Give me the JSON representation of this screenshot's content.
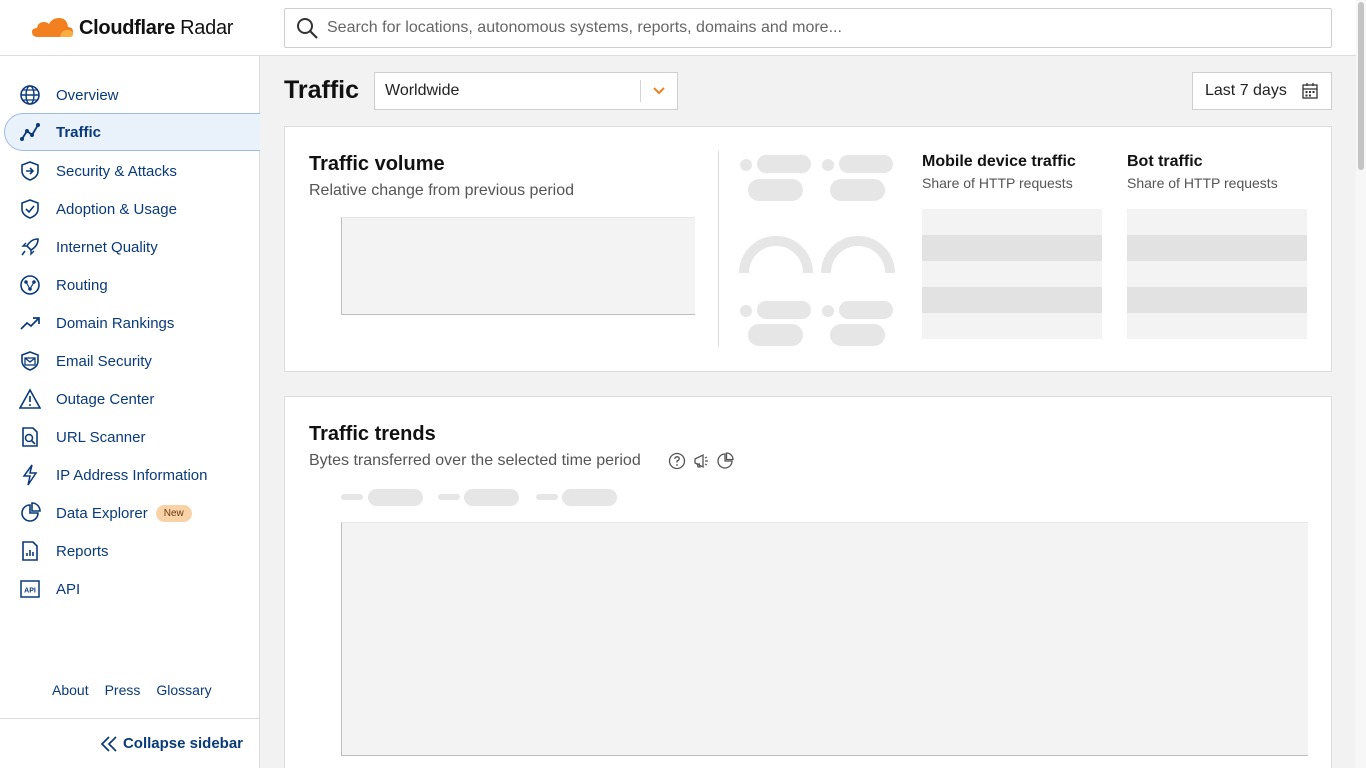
{
  "header": {
    "logo_brand": "Cloudflare",
    "logo_product": " Radar",
    "search_placeholder": "Search for locations, autonomous systems, reports, domains and more..."
  },
  "sidebar": {
    "items": [
      {
        "label": "Overview",
        "icon": "globe-icon"
      },
      {
        "label": "Traffic",
        "icon": "traffic-chart-icon",
        "active": true
      },
      {
        "label": "Security & Attacks",
        "icon": "shield-arrow-icon"
      },
      {
        "label": "Adoption & Usage",
        "icon": "shield-check-icon"
      },
      {
        "label": "Internet Quality",
        "icon": "rocket-icon"
      },
      {
        "label": "Routing",
        "icon": "routing-icon"
      },
      {
        "label": "Domain Rankings",
        "icon": "trend-up-icon"
      },
      {
        "label": "Email Security",
        "icon": "email-shield-icon"
      },
      {
        "label": "Outage Center",
        "icon": "warning-icon"
      },
      {
        "label": "URL Scanner",
        "icon": "doc-search-icon"
      },
      {
        "label": "IP Address Information",
        "icon": "bolt-icon"
      },
      {
        "label": "Data Explorer",
        "icon": "pie-icon",
        "badge": "New"
      },
      {
        "label": "Reports",
        "icon": "report-icon"
      },
      {
        "label": "API",
        "icon": "api-icon"
      }
    ],
    "footer_links": [
      "About",
      "Press",
      "Glossary"
    ],
    "collapse_label": "Collapse sidebar"
  },
  "main": {
    "title": "Traffic",
    "location": "Worldwide",
    "date_range": "Last 7 days",
    "volume_card": {
      "title": "Traffic volume",
      "subtitle": "Relative change from previous period",
      "mobile_title": "Mobile device traffic",
      "mobile_sub": "Share of HTTP requests",
      "bot_title": "Bot traffic",
      "bot_sub": "Share of HTTP requests"
    },
    "trends_card": {
      "title": "Traffic trends",
      "subtitle": "Bytes transferred over the selected time period"
    }
  },
  "colors": {
    "accent": "#f38020",
    "nav_text": "#0a3a7a",
    "active_bg": "#e9f1fb",
    "badge_bg": "#f9d2a8"
  }
}
